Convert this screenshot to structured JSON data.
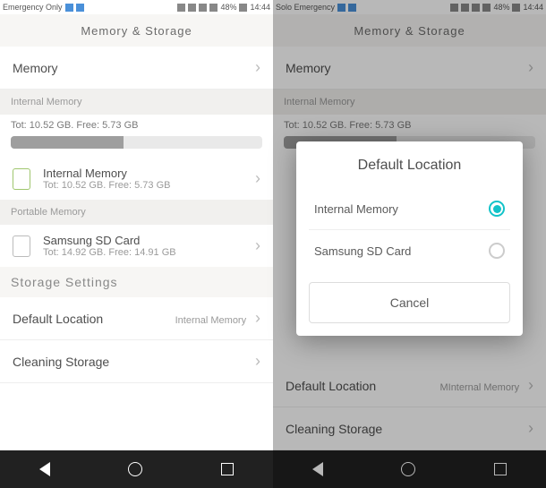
{
  "left": {
    "status": {
      "carrier": "Emergency Only",
      "battery": "48%",
      "time": "14:44"
    },
    "header_title": "Memory & Storage",
    "memory_row": "Memory",
    "internal_section": "Internal Memory",
    "internal_summary": "Tot: 10.52 GB. Free: 5.73 GB",
    "internal_item": {
      "title": "Internal Memory",
      "sub": "Tot: 10.52 GB. Free: 5.73 GB"
    },
    "portable_section": "Portable Memory",
    "sd_item": {
      "title": "Samsung SD Card",
      "sub": "Tot: 14.92 GB. Free: 14.91 GB"
    },
    "storage_settings_title": "Storage Settings",
    "default_location": {
      "label": "Default Location",
      "value": "Internal Memory"
    },
    "cleaning_storage": "Cleaning Storage"
  },
  "right": {
    "status": {
      "carrier": "Solo Emergency",
      "battery": "48%",
      "time": "14:44"
    },
    "header_title": "Memory & Storage",
    "memory_row": "Memory",
    "internal_section": "Internal Memory",
    "internal_summary": "Tot: 10.52 GB. Free: 5.73 GB",
    "default_location": {
      "label": "Default Location",
      "value": "MInternal Memory"
    },
    "cleaning_storage": "Cleaning Storage",
    "modal": {
      "title": "Default Location",
      "option1": "Internal Memory",
      "option2": "Samsung SD Card",
      "cancel": "Cancel"
    }
  },
  "progress_percent": 45
}
